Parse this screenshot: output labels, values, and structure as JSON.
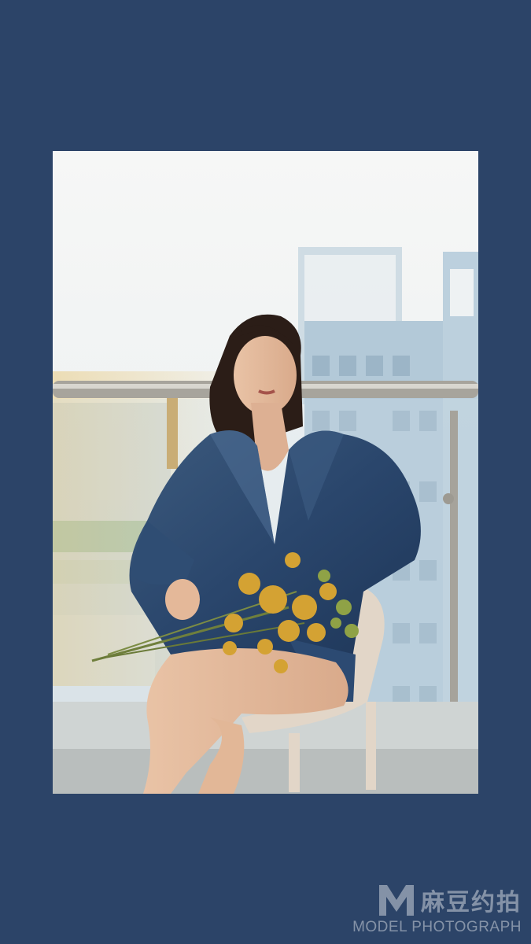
{
  "background_color": "#2c4468",
  "photo": {
    "subject": "woman-in-denim-jacket-holding-yellow-flowers",
    "setting": "balcony-with-city-buildings"
  },
  "watermark": {
    "logo_icon": "m-logo-icon",
    "brand_cn": "麻豆约拍",
    "brand_en": "MODEL PHOTOGRAPH"
  }
}
